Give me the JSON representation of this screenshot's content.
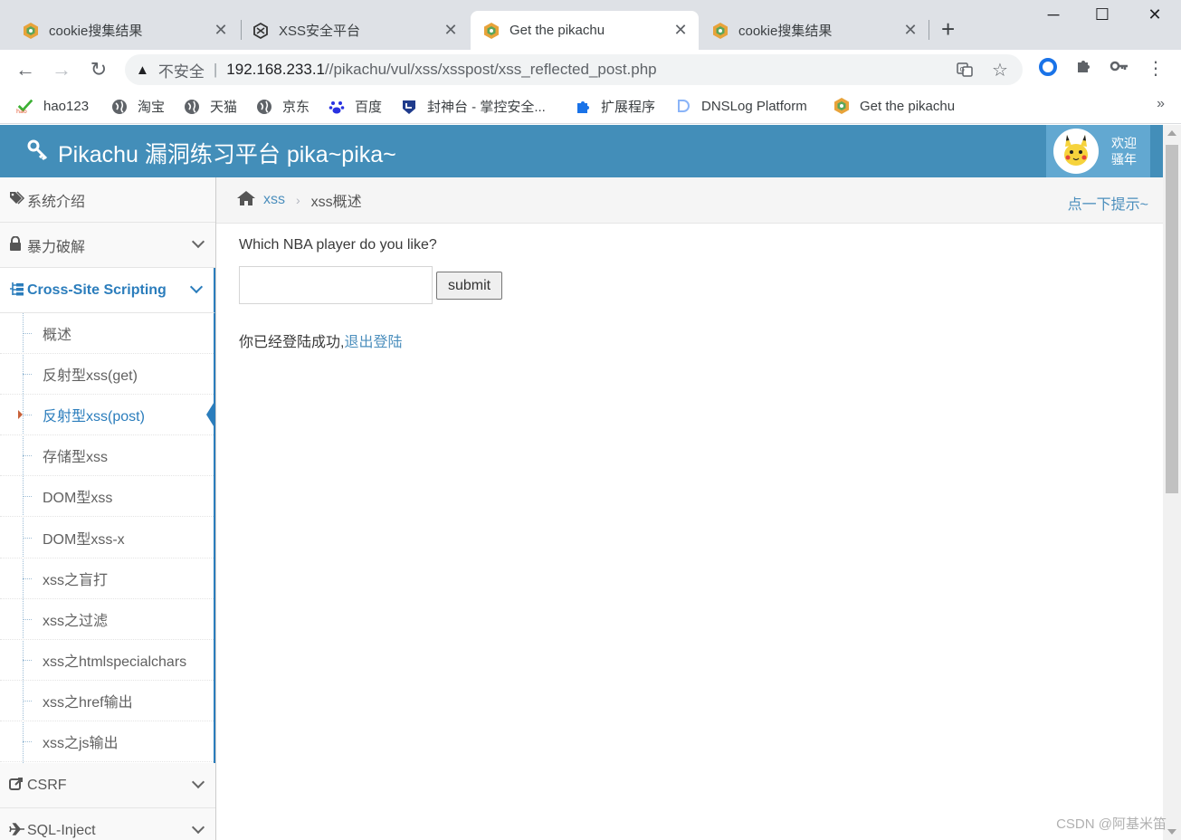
{
  "browser": {
    "tabs": [
      {
        "title": "cookie搜集结果",
        "icon": "pikachu-logo-icon",
        "active": false
      },
      {
        "title": "XSS安全平台",
        "icon": "xss-platform-icon",
        "active": false
      },
      {
        "title": "Get the pikachu",
        "icon": "pikachu-logo-icon",
        "active": true
      },
      {
        "title": "cookie搜集结果",
        "icon": "pikachu-logo-icon",
        "active": false
      }
    ],
    "address": {
      "security_label": "不安全",
      "host": "192.168.233.1",
      "path": "//pikachu/vul/xss/xsspost/xss_reflected_post.php"
    },
    "bookmarks": [
      {
        "label": "hao123",
        "icon": "hao123-icon"
      },
      {
        "label": "淘宝",
        "icon": "globe-icon"
      },
      {
        "label": "天猫",
        "icon": "globe-icon"
      },
      {
        "label": "京东",
        "icon": "globe-icon"
      },
      {
        "label": "百度",
        "icon": "baidu-paw-icon"
      },
      {
        "label": "封神台 - 掌控安全...",
        "icon": "fengshentai-icon"
      },
      {
        "label": "扩展程序",
        "icon": "puzzle-icon"
      },
      {
        "label": "DNSLog Platform",
        "icon": "dnslog-icon"
      },
      {
        "label": "Get the pikachu",
        "icon": "pikachu-logo-icon"
      }
    ],
    "bookmarks_more": "»"
  },
  "app": {
    "brand": "Pikachu 漏洞练习平台 pika~pika~",
    "welcome_line1": "欢迎",
    "welcome_line2": "骚年"
  },
  "sidebar": {
    "sections": [
      {
        "label": "系统介绍",
        "icon": "tags-icon",
        "has_chevron": false
      },
      {
        "label": "暴力破解",
        "icon": "lock-icon",
        "has_chevron": true
      },
      {
        "label": "Cross-Site Scripting",
        "icon": "sitemap-icon",
        "has_chevron": true,
        "open": true
      }
    ],
    "xss_items": [
      "概述",
      "反射型xss(get)",
      "反射型xss(post)",
      "存储型xss",
      "DOM型xss",
      "DOM型xss-x",
      "xss之盲打",
      "xss之过滤",
      "xss之htmlspecialchars",
      "xss之href输出",
      "xss之js输出"
    ],
    "active_item_index": 2,
    "after_sections": [
      {
        "label": "CSRF",
        "icon": "share-icon"
      },
      {
        "label": "SQL-Inject",
        "icon": "plane-icon"
      }
    ]
  },
  "breadcrumb": {
    "link": "xss",
    "current": "xss概述",
    "hint": "点一下提示~"
  },
  "content": {
    "question": "Which NBA player do you like?",
    "input_value": "",
    "submit_label": "submit",
    "status_text": "你已经登陆成功,",
    "logout_link": "退出登陆"
  },
  "watermark": "CSDN @阿基米笛",
  "colors": {
    "navbar": "#438eb9",
    "accent": "#2b7dbc",
    "link": "#4c8fbd"
  }
}
